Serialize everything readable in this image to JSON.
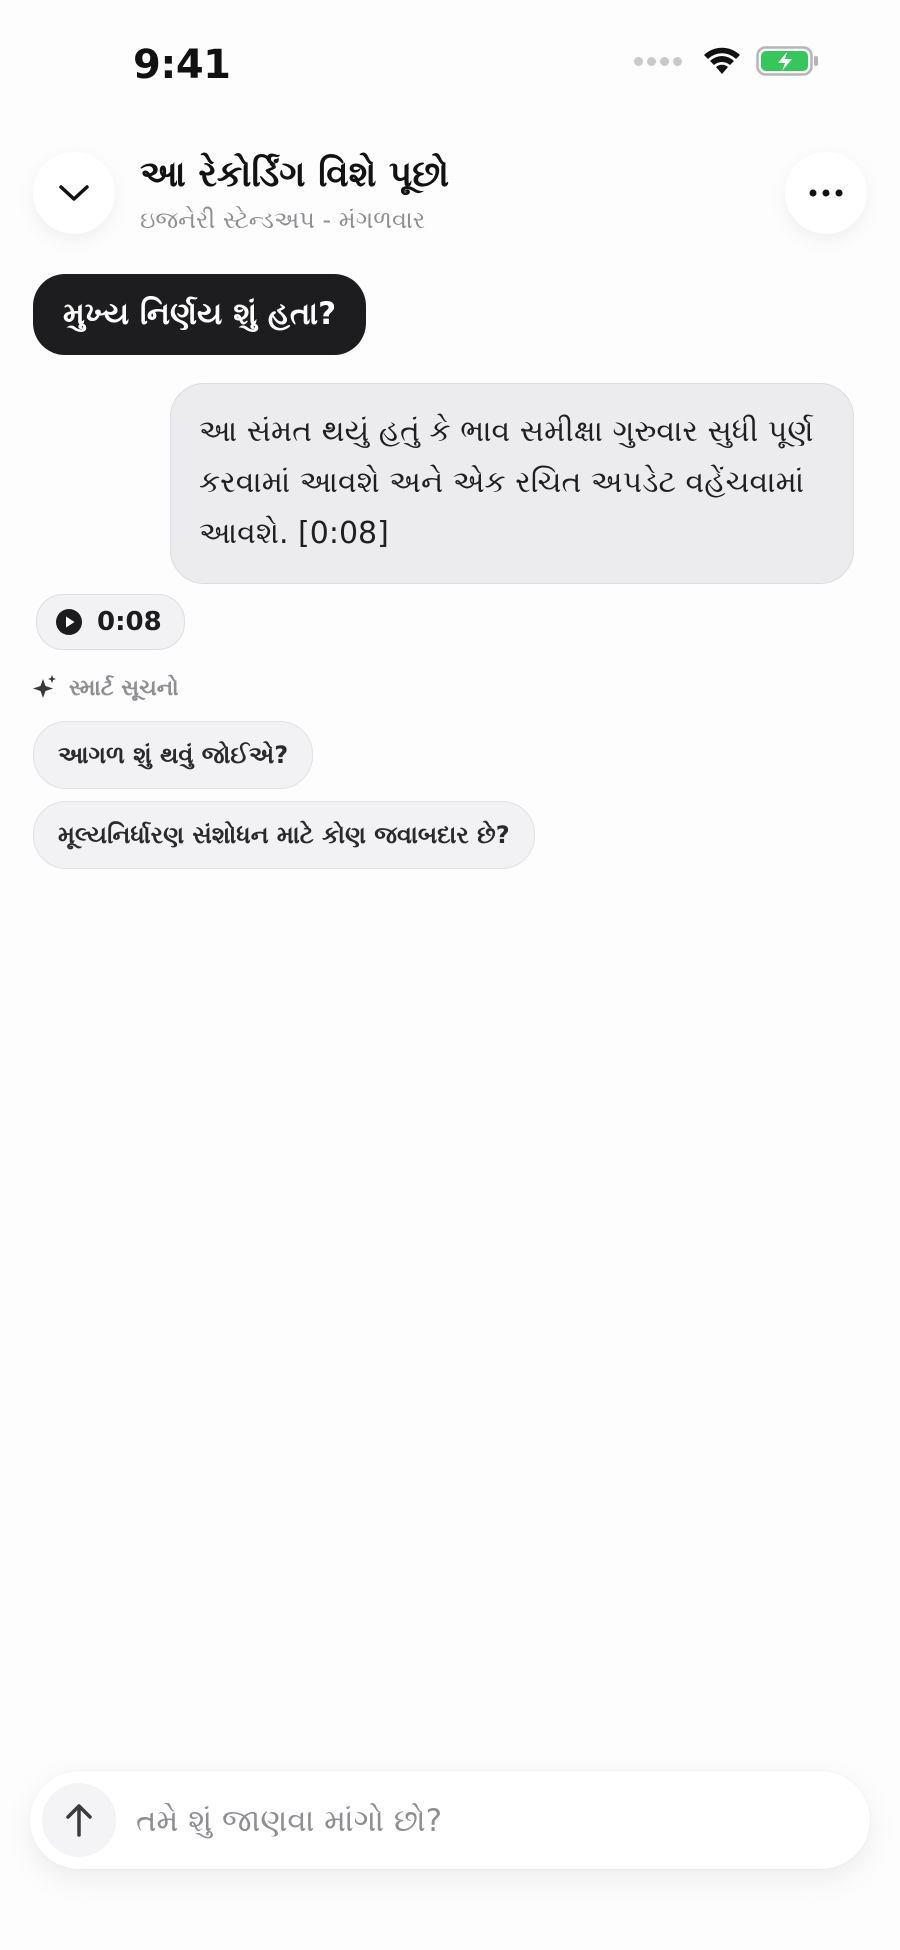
{
  "status_bar": {
    "time": "9:41"
  },
  "header": {
    "title": "આ રેકોર્ડિંગ વિશે પૂછો",
    "subtitle": "ઇજનેરી સ્ટેન્ડઅપ - મંગળવાર"
  },
  "chat": {
    "user_message": "મુખ્ય નિર્ણય શું હતા?",
    "assistant_message": "આ સંમત થયું હતું કે ભાવ સમીક્ષા ગુરુવાર સુધી પૂર્ણ કરવામાં આવશે અને એક રચિત અપડેટ વહેંચવામાં આવશે. [0:08]",
    "audio_timestamp": "0:08"
  },
  "suggestions": {
    "label": "સ્માર્ટ સૂચનો",
    "items": [
      "આગળ શું થવું જોઈએ?",
      "મૂલ્યનિર્ધારણ સંશોધન માટે કોણ જવાબદાર છે?"
    ]
  },
  "composer": {
    "placeholder": "તમે શું જાણવા માંગો છો?",
    "value": ""
  },
  "colors": {
    "user_bubble": "#1d1d1f",
    "assistant_bubble": "#ececee",
    "battery_fill": "#34c759",
    "muted_text": "#8e8e93"
  },
  "icons": {
    "back": "chevron-down-icon",
    "more": "ellipsis-icon",
    "play": "play-icon",
    "sparkle": "sparkle-icon",
    "send": "arrow-up-icon",
    "wifi": "wifi-icon",
    "battery": "battery-charging-icon",
    "signal": "signal-icon"
  }
}
